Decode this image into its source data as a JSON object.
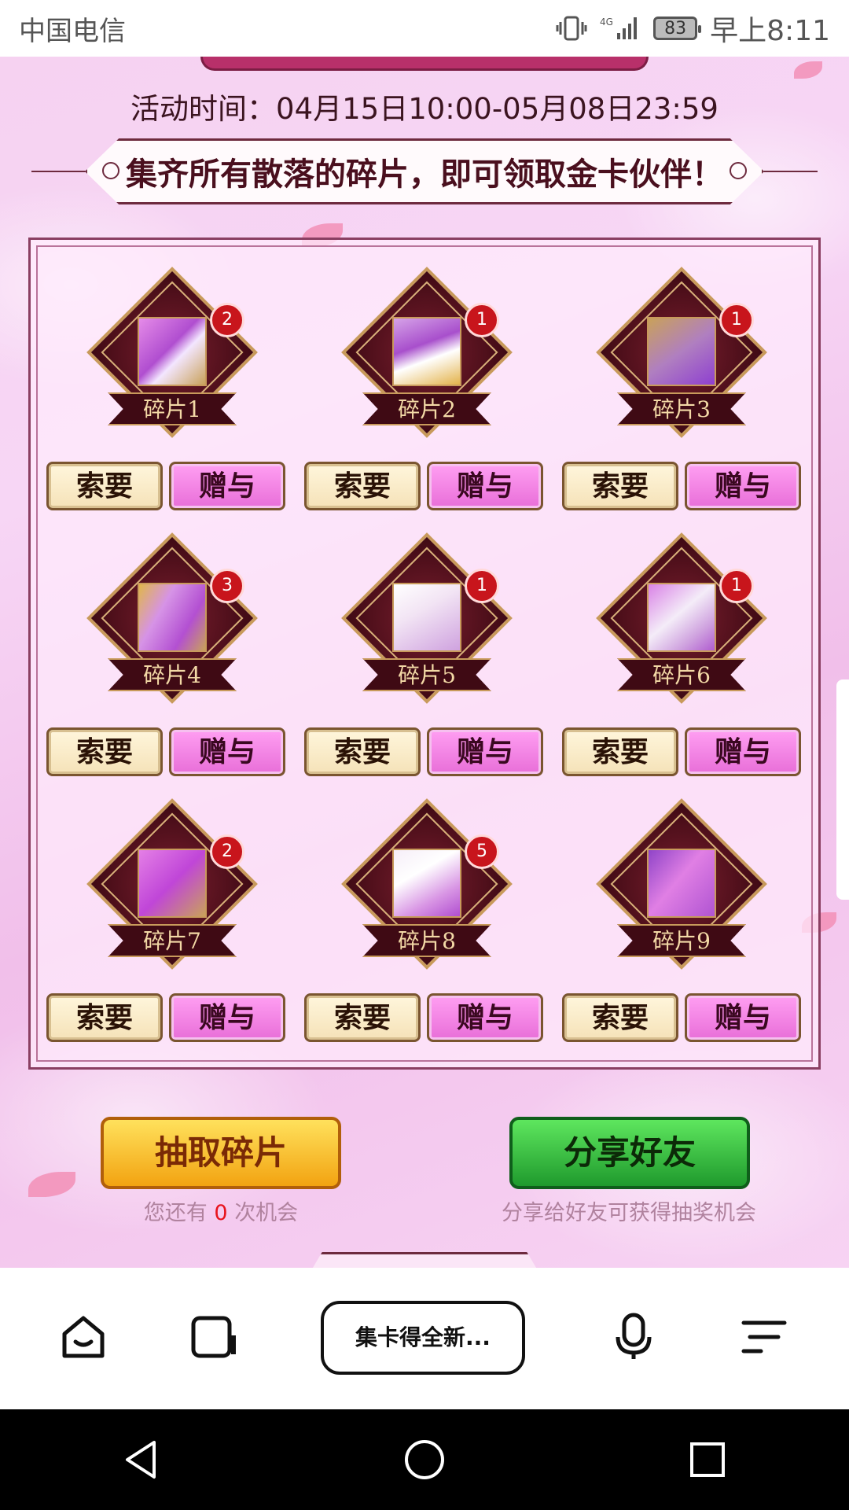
{
  "status_bar": {
    "carrier": "中国电信",
    "battery": "83",
    "time": "早上8:11",
    "network": "4G"
  },
  "event": {
    "activity_time": "活动时间：04月15日10:00-05月08日23:59",
    "subtitle": "集齐所有散落的碎片，即可领取金卡伙伴！"
  },
  "shards": [
    {
      "label": "碎片1",
      "count": "2",
      "request_label": "索要",
      "give_label": "赠与"
    },
    {
      "label": "碎片2",
      "count": "1",
      "request_label": "索要",
      "give_label": "赠与"
    },
    {
      "label": "碎片3",
      "count": "1",
      "request_label": "索要",
      "give_label": "赠与"
    },
    {
      "label": "碎片4",
      "count": "3",
      "request_label": "索要",
      "give_label": "赠与"
    },
    {
      "label": "碎片5",
      "count": "1",
      "request_label": "索要",
      "give_label": "赠与"
    },
    {
      "label": "碎片6",
      "count": "1",
      "request_label": "索要",
      "give_label": "赠与"
    },
    {
      "label": "碎片7",
      "count": "2",
      "request_label": "索要",
      "give_label": "赠与"
    },
    {
      "label": "碎片8",
      "count": "5",
      "request_label": "索要",
      "give_label": "赠与"
    },
    {
      "label": "碎片9",
      "count": "",
      "request_label": "索要",
      "give_label": "赠与"
    }
  ],
  "actions": {
    "draw_label": "抽取碎片",
    "chance_prefix": "您还有",
    "chance_count": "0",
    "chance_suffix": "次机会",
    "share_label": "分享好友",
    "share_note": "分享给好友可获得抽奖机会"
  },
  "browser_bar": {
    "title": "集卡得全新...",
    "icons": [
      "home-icon",
      "tabs-icon",
      "microphone-icon",
      "menu-icon"
    ]
  },
  "nav_bar": {
    "icons": [
      "back-icon",
      "home-circle-icon",
      "recents-icon"
    ]
  },
  "colors": {
    "page_bg": "#f3c9ef",
    "badge": "#c8151c",
    "request_button": "#f5e2b8",
    "give_button": "#e86ed8",
    "draw_button": "#f2a311",
    "share_button": "#1f9a2d",
    "chance_count": "#e8131d"
  }
}
